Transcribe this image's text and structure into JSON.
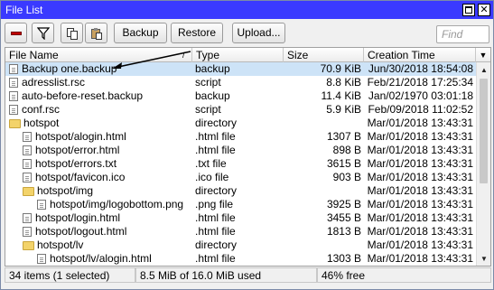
{
  "window": {
    "title": "File List"
  },
  "toolbar": {
    "remove_icon": "minus-icon",
    "filter_icon": "filter-icon",
    "copy_icon": "copy-icon",
    "paste_icon": "paste-icon",
    "backup_label": "Backup",
    "restore_label": "Restore",
    "upload_label": "Upload...",
    "find_placeholder": "Find"
  },
  "table": {
    "columns": [
      "File Name",
      "Type",
      "Size",
      "Creation Time"
    ],
    "rows": [
      {
        "name": "Backup one.backup",
        "type": "backup",
        "size": "70.9 KiB",
        "date": "Jun/30/2018 18:54:08",
        "kind": "file",
        "indent": 0,
        "selected": true
      },
      {
        "name": "adresslist.rsc",
        "type": "script",
        "size": "8.8 KiB",
        "date": "Feb/21/2018 17:25:34",
        "kind": "file",
        "indent": 0
      },
      {
        "name": "auto-before-reset.backup",
        "type": "backup",
        "size": "11.4 KiB",
        "date": "Jan/02/1970 03:01:18",
        "kind": "file",
        "indent": 0
      },
      {
        "name": "conf.rsc",
        "type": "script",
        "size": "5.9 KiB",
        "date": "Feb/09/2018 11:02:52",
        "kind": "file",
        "indent": 0
      },
      {
        "name": "hotspot",
        "type": "directory",
        "size": "",
        "date": "Mar/01/2018 13:43:31",
        "kind": "dir",
        "indent": 0
      },
      {
        "name": "hotspot/alogin.html",
        "type": ".html file",
        "size": "1307 B",
        "date": "Mar/01/2018 13:43:31",
        "kind": "file",
        "indent": 1
      },
      {
        "name": "hotspot/error.html",
        "type": ".html file",
        "size": "898 B",
        "date": "Mar/01/2018 13:43:31",
        "kind": "file",
        "indent": 1
      },
      {
        "name": "hotspot/errors.txt",
        "type": ".txt file",
        "size": "3615 B",
        "date": "Mar/01/2018 13:43:31",
        "kind": "file",
        "indent": 1
      },
      {
        "name": "hotspot/favicon.ico",
        "type": ".ico file",
        "size": "903 B",
        "date": "Mar/01/2018 13:43:31",
        "kind": "file",
        "indent": 1
      },
      {
        "name": "hotspot/img",
        "type": "directory",
        "size": "",
        "date": "Mar/01/2018 13:43:31",
        "kind": "dir",
        "indent": 1
      },
      {
        "name": "hotspot/img/logobottom.png",
        "type": ".png file",
        "size": "3925 B",
        "date": "Mar/01/2018 13:43:31",
        "kind": "file",
        "indent": 2
      },
      {
        "name": "hotspot/login.html",
        "type": ".html file",
        "size": "3455 B",
        "date": "Mar/01/2018 13:43:31",
        "kind": "file",
        "indent": 1
      },
      {
        "name": "hotspot/logout.html",
        "type": ".html file",
        "size": "1813 B",
        "date": "Mar/01/2018 13:43:31",
        "kind": "file",
        "indent": 1
      },
      {
        "name": "hotspot/lv",
        "type": "directory",
        "size": "",
        "date": "Mar/01/2018 13:43:31",
        "kind": "dir",
        "indent": 1
      },
      {
        "name": "hotspot/lv/alogin.html",
        "type": ".html file",
        "size": "1303 B",
        "date": "Mar/01/2018 13:43:31",
        "kind": "file",
        "indent": 2
      }
    ]
  },
  "status": {
    "items": "34 items (1 selected)",
    "usage": "8.5 MiB of 16.0 MiB used",
    "free": "46% free"
  }
}
